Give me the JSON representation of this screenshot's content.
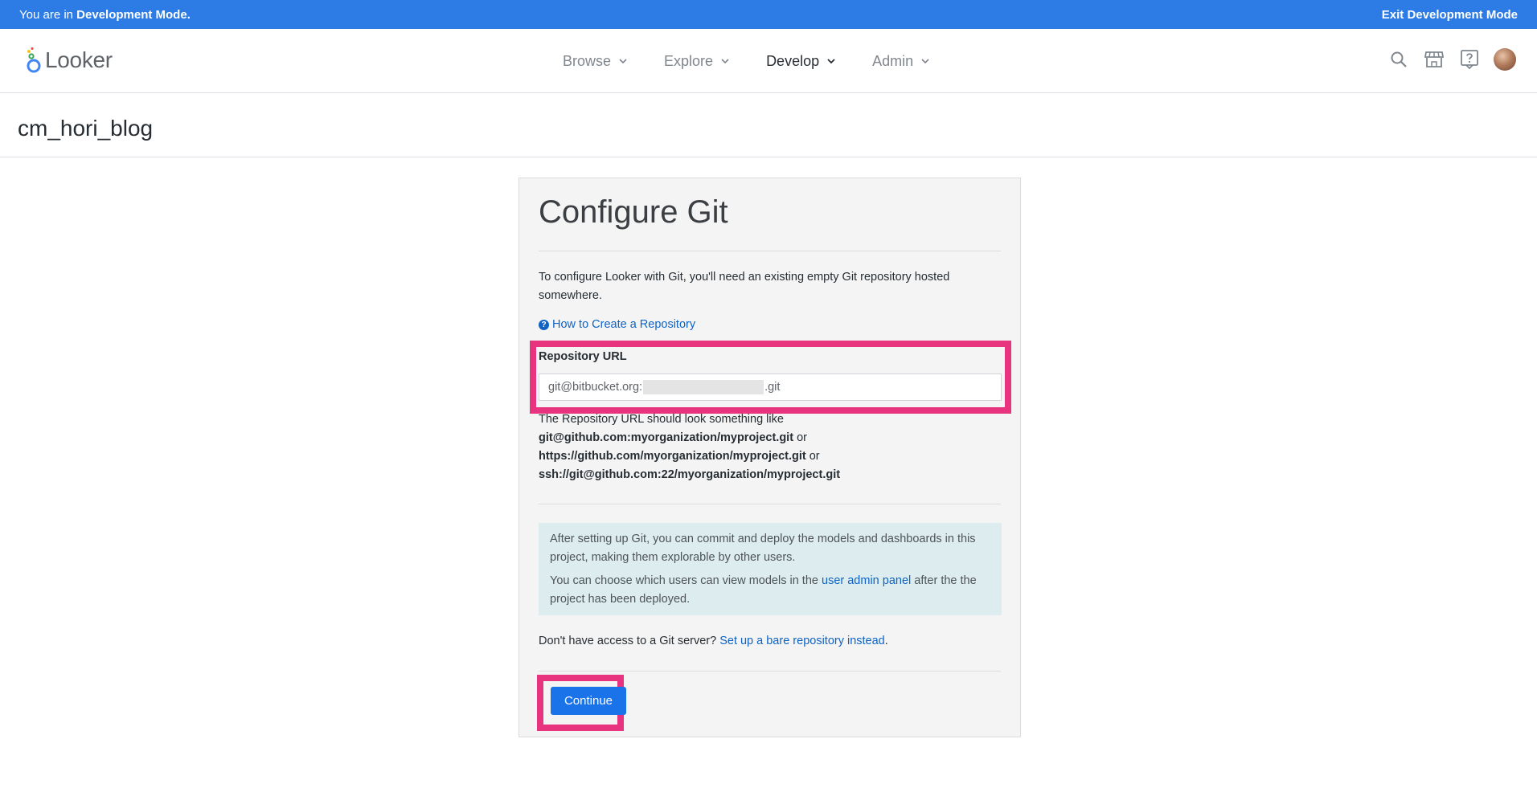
{
  "devbar": {
    "prefix": "You are in ",
    "mode": "Development Mode.",
    "exit_label": "Exit Development Mode"
  },
  "nav": {
    "logo_text": "Looker",
    "items": [
      {
        "label": "Browse",
        "active": false
      },
      {
        "label": "Explore",
        "active": false
      },
      {
        "label": "Develop",
        "active": true
      },
      {
        "label": "Admin",
        "active": false
      }
    ],
    "icons": [
      "search-icon",
      "marketplace-icon",
      "help-icon",
      "avatar"
    ]
  },
  "project": {
    "name": "cm_hori_blog"
  },
  "configure": {
    "title": "Configure Git",
    "intro": "To configure Looker with Git, you'll need an existing empty Git repository hosted somewhere.",
    "howto_link": "How to Create a Repository",
    "repo_label": "Repository URL",
    "repo_value_prefix": "git@bitbucket.org:",
    "repo_value_suffix": ".git",
    "help_intro": "The Repository URL should look something like",
    "example_1": "git@github.com:myorganization/myproject.git",
    "example_2": "https://github.com/myorganization/myproject.git",
    "example_3": "ssh://git@github.com:22/myorganization/myproject.git",
    "or": " or",
    "info_1": "After setting up Git, you can commit and deploy the models and dashboards in this project, making them explorable by other users.",
    "info_2_pre": "You can choose which users can view models in the ",
    "info_2_link": "user admin panel",
    "info_2_post": " after the the project has been deployed.",
    "bare_pre": "Don't have access to a Git server? ",
    "bare_link": "Set up a bare repository instead",
    "bare_post": ".",
    "continue_label": "Continue"
  },
  "colors": {
    "devbar": "#2d7be5",
    "link": "#0e63c5",
    "button": "#1a73e8",
    "highlight": "#e8347e",
    "info_bg": "#ddedef"
  }
}
